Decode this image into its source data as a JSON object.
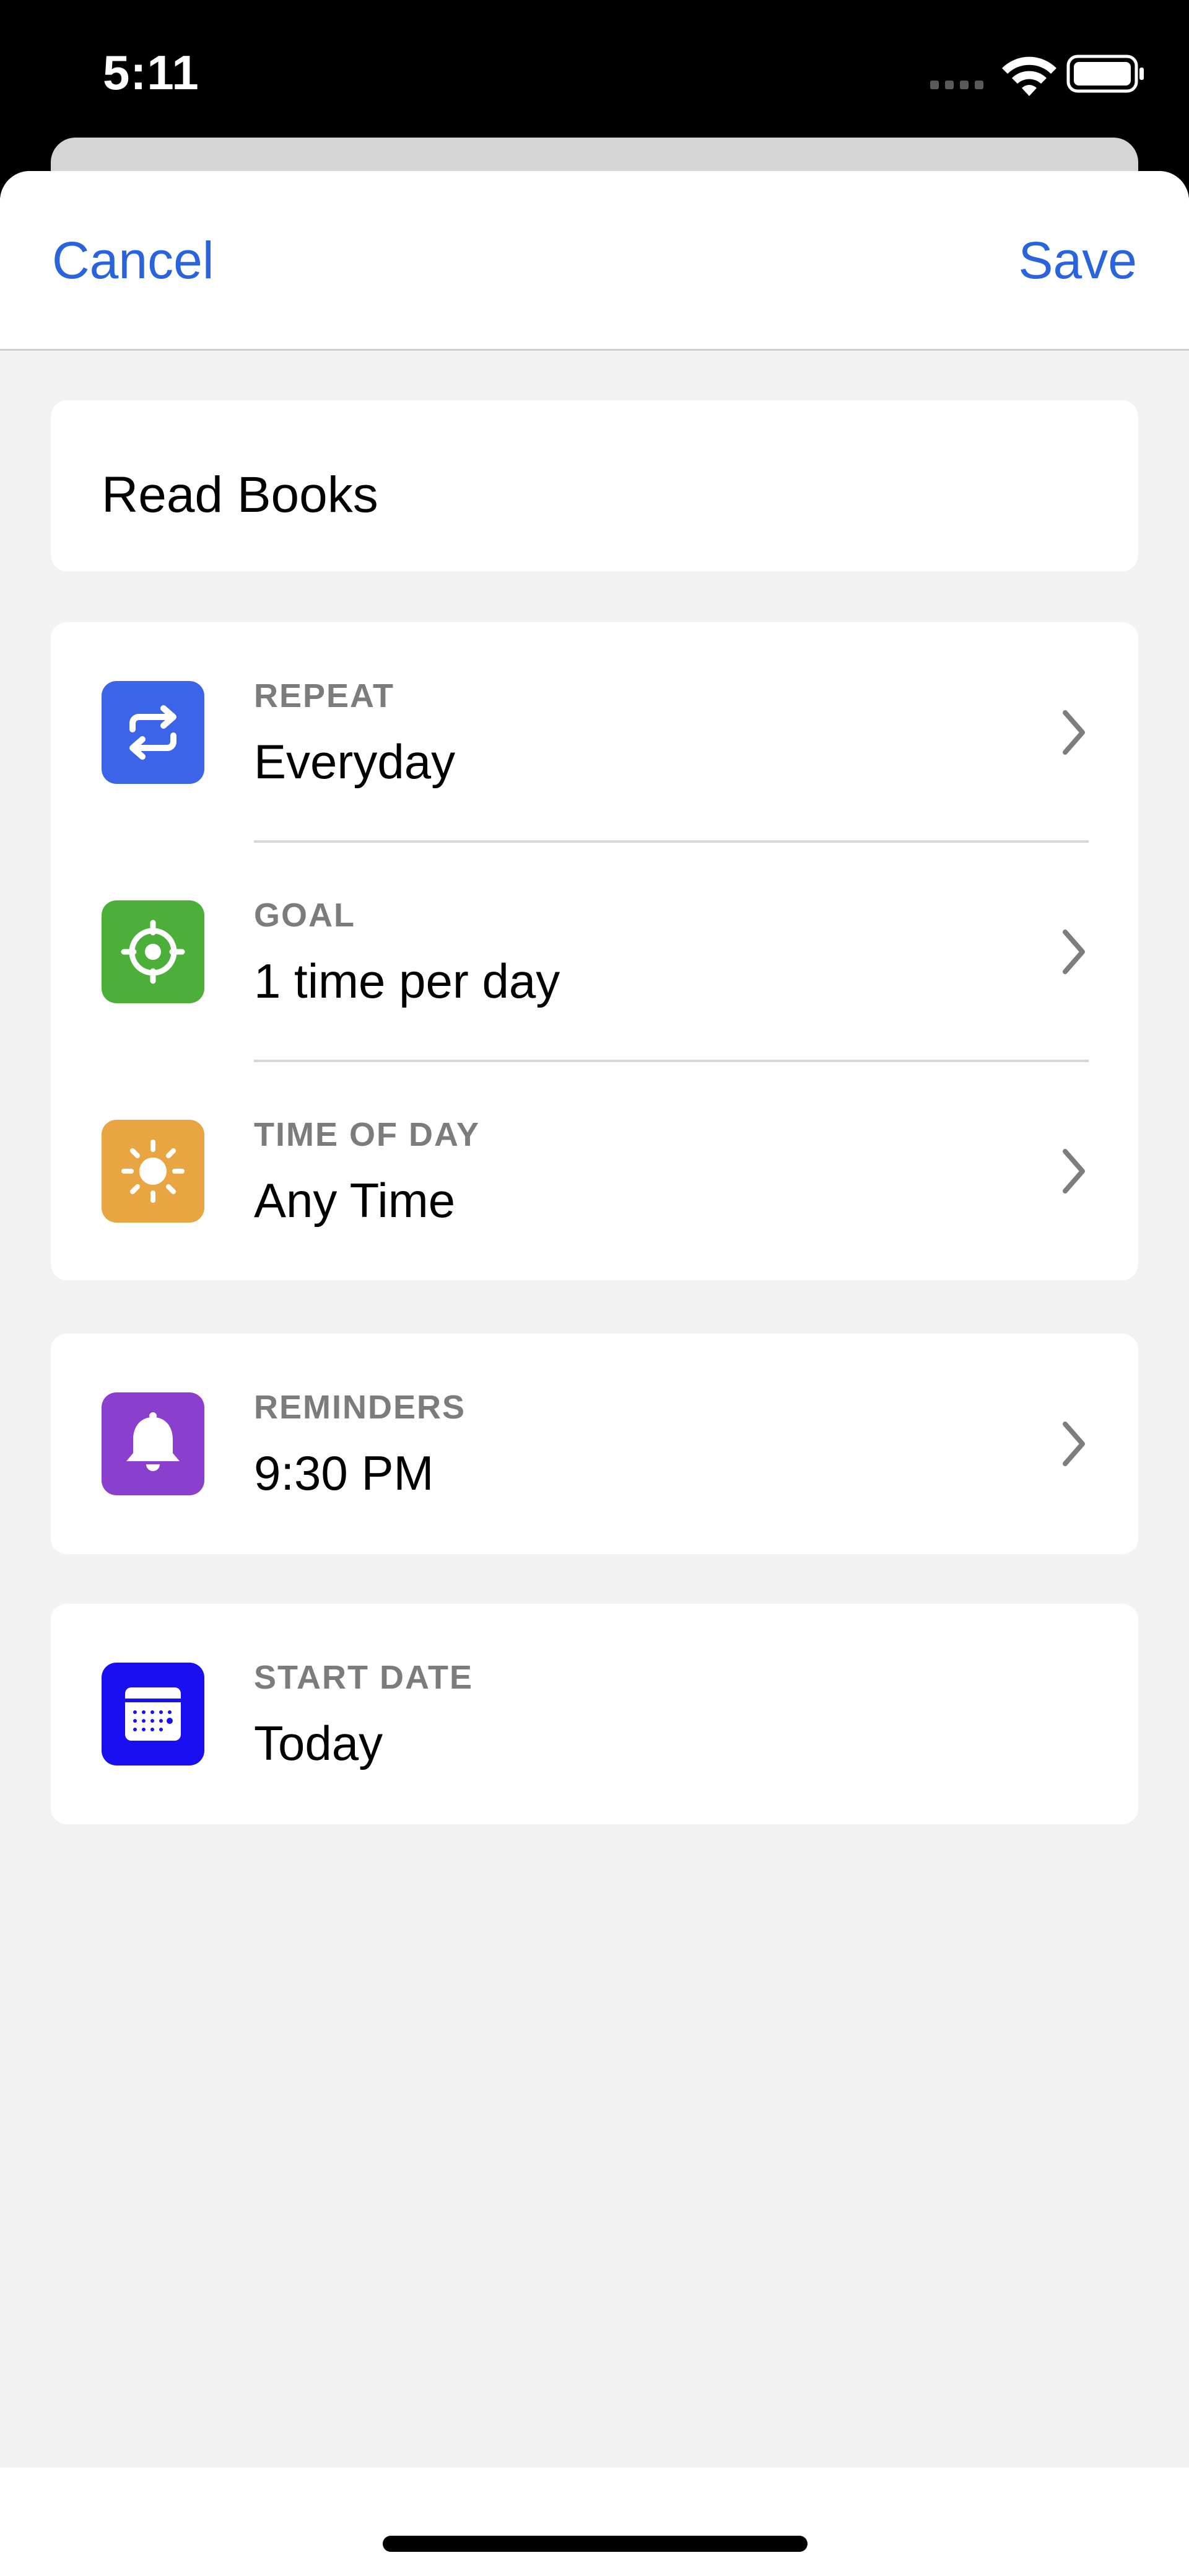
{
  "status_bar": {
    "time": "5:11",
    "signal_icon": "signal-icon",
    "wifi_icon": "wifi-icon",
    "battery_icon": "battery-icon"
  },
  "nav": {
    "cancel_label": "Cancel",
    "save_label": "Save"
  },
  "habit": {
    "name": "Read Books"
  },
  "settings": {
    "repeat": {
      "label": "REPEAT",
      "value": "Everyday",
      "icon": "repeat-icon",
      "color": "#3b64e8"
    },
    "goal": {
      "label": "GOAL",
      "value": "1 time per day",
      "icon": "target-icon",
      "color": "#4caf3a"
    },
    "time_of_day": {
      "label": "TIME OF DAY",
      "value": "Any Time",
      "icon": "sun-icon",
      "color": "#e8a542"
    },
    "reminders": {
      "label": "REMINDERS",
      "value": "9:30 PM",
      "icon": "bell-icon",
      "color": "#8b3fcf"
    },
    "start_date": {
      "label": "START DATE",
      "value": "Today",
      "icon": "calendar-icon",
      "color": "#1a0ff0"
    }
  },
  "colors": {
    "accent": "#2a64dc",
    "background": "#f2f2f2"
  }
}
